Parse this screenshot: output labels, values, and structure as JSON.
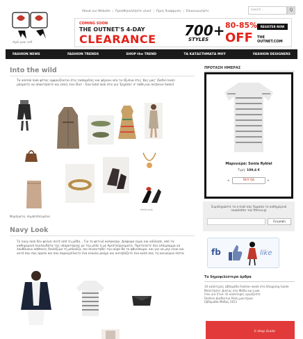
{
  "header": {
    "logo_tagline": "style your self",
    "top_links": [
      "About our Website",
      "Προσθηκολλήστε υλικό",
      "Προς διαφήμιση",
      "Επικοινωνήστε"
    ],
    "search_placeholder": "search ...",
    "search_button": "Q"
  },
  "banner": {
    "coming_soon": "COMING SOON",
    "line1": "THE OUTNET'S 4-DAY",
    "line2": "CLEARANCE",
    "big_number": "700+",
    "styles": "STYLES",
    "percent": "80-85%",
    "off": "OFF",
    "cta": "REGISTER NOW",
    "site": "THE OUTNET.COM"
  },
  "main_nav": [
    "FASHION NEWS",
    "FASHION TRENDS",
    "SHOP the TREND",
    "ΤΑ ΚΑΤΑΣΤΗΜΑΤΑ ΜΟΥ",
    "FASHION DESIGNERS"
  ],
  "section1": {
    "title": "Into the wild",
    "text": "Τα animal look φέτος εμφανίζονται στις πασαρέλες και φέρουν νέα τα έξυπνα στις 'Δες μας' (Safari look) μπορείτε να αποκτήσετε και εσείς ένα ίδιο! - Ένα total look στα για 'ξεχάσει' σ' λάθη και Instance Select",
    "caption": "Απλά look",
    "tags": "Φορέματα, συμπεπλεγμένα"
  },
  "section2": {
    "title": "Navy Look",
    "text": "Το navy look δεν φεύγει ποτέ από τη μόδα... Για το φετινό καλοκαίρι. Διάφορα είμαι και κόλλησε, από τα καθημερινά λουλουδάτα της υπαρκτάριας με την μπλε ή με Αριστούργηματα. Προτείνετε ένα ολόγραμμα να λανθάνουν ασθενείς διαλέξιμα τη μπλούζα, πιο συναντηθεί την αύρα θα το φθινόπωρο. και για να μην είναι και αυτό που σας άρεσε και που παραγγέλνετε ένα εύκολο ρούχο και κατεβάζετε ένα καλό σας τη καινούρια λίστα."
  },
  "sidebar": {
    "product_of_day_title": "ΠΡΟΤΑΣΗ ΗΜΕΡΑΣ",
    "product_name": "Μαρινιέρα: Sonia Rykiel",
    "price_label": "Τιμή:",
    "price_value": "109,6 €",
    "buy_label": "BUY ΕΔ",
    "newsletter_text": "Συμπληρώστε το e-mail σας δωρεάν το καθημερινό newsletter του fthinoi.gr",
    "subscribe_label": "Εγγραφή",
    "fb_label": "fb",
    "like_label": "like",
    "popular_title": "Τα δημοφιλέστερα άρθρα",
    "popular_items": [
      "10 καλύτερες εβδομάδα Fashion week στο Shopping Guide",
      "Μελετήστε: Διάτος στο Μόδα και Look",
      "Ιτον για Στυλ: Οι καλύτερες εργάζεστε",
      "Fashion Διαδίκτυο Άλλη μοντέρνα",
      "Εβδομάδα Μόδας 2011"
    ],
    "eshop_label": "E-shop Guide"
  },
  "colors": {
    "nav_bg": "#1a1a1a",
    "accent_red": "#e2231a",
    "section_title": "#8a8a8a",
    "facebook_blue": "#3b5998"
  }
}
